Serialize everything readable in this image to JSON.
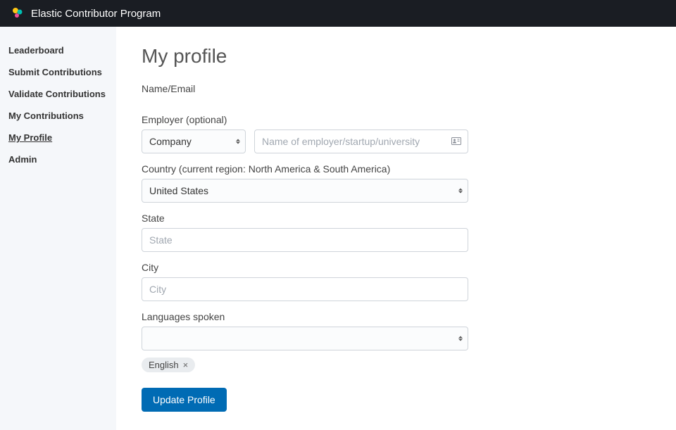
{
  "header": {
    "title": "Elastic Contributor Program"
  },
  "sidebar": {
    "items": [
      {
        "label": "Leaderboard"
      },
      {
        "label": "Submit Contributions"
      },
      {
        "label": "Validate Contributions"
      },
      {
        "label": "My Contributions"
      },
      {
        "label": "My Profile"
      },
      {
        "label": "Admin"
      }
    ],
    "activeIndex": 4
  },
  "page": {
    "title": "My profile",
    "name_email_label": "Name/Email",
    "employer_label": "Employer (optional)",
    "employer_type_value": "Company",
    "employer_name_placeholder": "Name of employer/startup/university",
    "country_label": "Country (current region: North America & South America)",
    "country_value": "United States",
    "state_label": "State",
    "state_placeholder": "State",
    "city_label": "City",
    "city_placeholder": "City",
    "languages_label": "Languages spoken",
    "languages_selected": "",
    "language_tags": [
      {
        "label": "English"
      }
    ],
    "submit_label": "Update Profile"
  }
}
